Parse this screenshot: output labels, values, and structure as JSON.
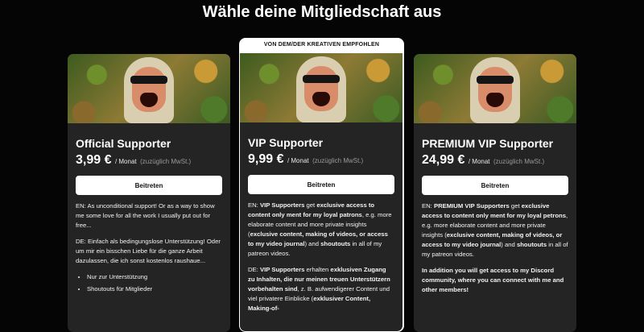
{
  "page": {
    "title": "Wähle deine Mitgliedschaft aus"
  },
  "tiers": [
    {
      "name": "Official Supporter",
      "price": "3,99 €",
      "per": "/ Monat",
      "tax": "(zuzüglich MwSt.)",
      "button": "Beitreten",
      "desc_en": "EN: As unconditional support! Or as a way to show me some love for all the work I usually put out for free...",
      "desc_de": "DE: Einfach als bedingungslose Unterstützung! Oder um mir ein bisschen Liebe für die ganze Arbeit dazulassen, die ich sonst kostenlos raushaue...",
      "bullets": [
        "Nur zur Unterstützung",
        "Shoutouts für Mitglieder"
      ]
    },
    {
      "recommended_label": "VON DEM/DER KREATIVEN EMPFOHLEN",
      "name": "VIP Supporter",
      "price": "9,99 €",
      "per": "/ Monat",
      "tax": "(zuzüglich MwSt.)",
      "button": "Beitreten",
      "en": {
        "t1": "EN: ",
        "b1": "VIP Supporters",
        "t2": " get ",
        "b2": "exclusive access to content only ment for my loyal patrons",
        "t3": ", e.g. more elaborate content and more private insights (",
        "b3": "exclusive content, making of videos, or access to my video journal",
        "t4": ") and ",
        "b4": "shoutouts",
        "t5": " in all of my patreon videos."
      },
      "de": {
        "t1": "DE: ",
        "b1": "VIP Supporters",
        "t2": " erhalten ",
        "b2": "exklusiven Zugang zu Inhalten, die nur meinen treuen Unterstützern vorbehalten sind",
        "t3": ", z. B. aufwendigerer Content und viel privatere Einblicke (",
        "b3": "exklusiver Content, Making-of-"
      }
    },
    {
      "name": "PREMIUM VIP Supporter",
      "price": "24,99 €",
      "per": "/ Monat",
      "tax": "(zuzüglich MwSt.)",
      "button": "Beitreten",
      "en": {
        "t1": "EN: ",
        "b1": "PREMIUM VIP Supporters",
        "t2": " get ",
        "b2": "exclusive access to content only ment for my loyal petrons",
        "t3": ", e.g. more elaborate content and more private insights (",
        "b3": "exclusive content, making of videos, or access to my video journal",
        "t4": ") and ",
        "b4": "shoutouts",
        "t5": " in all of my patreon videos."
      },
      "extra": "In addition you will get access to my Discord community, where you can connect with me and other members!"
    }
  ]
}
